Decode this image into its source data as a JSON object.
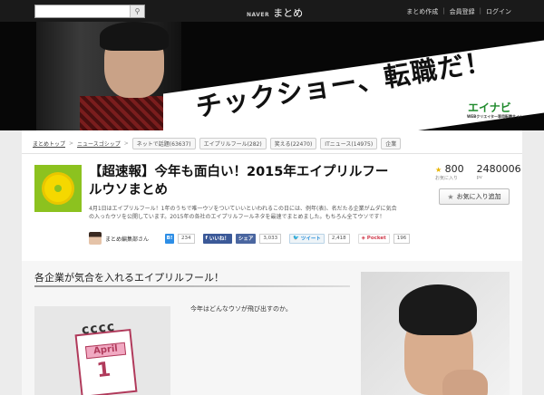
{
  "topbar": {
    "search_placeholder": "",
    "brand_small": "NAVER",
    "brand": "まとめ",
    "links": [
      "まとめ作成",
      "会員登録",
      "ログイン"
    ]
  },
  "banner": {
    "headline": "チックショー、転職だ！",
    "logo": "エイナビ",
    "logo_sub": "WEBクリエイター専用転職サイト"
  },
  "breadcrumb": {
    "items": [
      "まとめトップ",
      "ニュースゴシップ"
    ],
    "tags": [
      "ネットで話題(63637)",
      "エイプリルフール(282)",
      "笑える(22470)",
      "ITニュース(14975)",
      "企業"
    ]
  },
  "article": {
    "title": "【超速報】今年も面白い！2015年エイプリルフールウソまとめ",
    "description": "4月1日はエイプリルフール！1年のうちで唯一ウソをついていいといわれるこの日には、例年(表)、名だたる企業がムダに気合の入ったウソを公開しています。2015年の各社のエイプリルフールネタを最速でまとめました。もちろん全てウソです！",
    "favorites": "800",
    "favorites_label": "お気に入り",
    "views": "2480006",
    "views_label": "pv",
    "fav_button": "お気に入り追加",
    "author": "まとめ編集部さん",
    "social": {
      "hatena": "B!",
      "hatena_count": "234",
      "like": "いいね！",
      "share": "シェア",
      "share_count": "3,033",
      "tweet": "ツイート",
      "tweet_count": "2,418",
      "pocket": "Pocket",
      "pocket_count": "196"
    }
  },
  "content": {
    "section_title": "各企業が気合を入れるエイプリルフール！",
    "calendar_month": "April",
    "calendar_day": "1",
    "text": "今年はどんなウソが飛び出すのか。"
  }
}
